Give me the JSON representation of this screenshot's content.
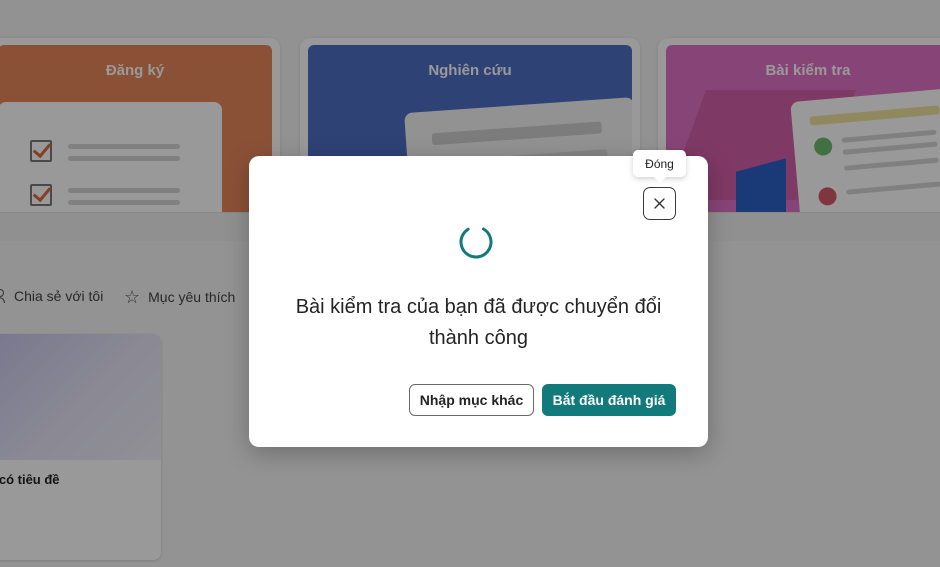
{
  "templates": [
    {
      "label": "Đăng ký"
    },
    {
      "label": "Nghiên cứu"
    },
    {
      "label": "Bài kiểm tra"
    }
  ],
  "filters": {
    "shared_label": "Chia sẻ với tôi",
    "favorites_label": "Mục yêu thích"
  },
  "form_tile": {
    "title": "a có tiêu đề"
  },
  "dialog": {
    "message": "Bài kiểm tra của bạn đã được chuyển đổi thành công",
    "secondary_button": "Nhập mục khác",
    "primary_button": "Bắt đầu đánh giá",
    "close_tooltip": "Đóng",
    "close_icon": "close-icon",
    "spinner_color": "#127a7a"
  },
  "colors": {
    "accent": "#127a7a",
    "register_card": "#e8885c",
    "research_card": "#4d6fc4",
    "quiz_card": "#e273c6"
  }
}
